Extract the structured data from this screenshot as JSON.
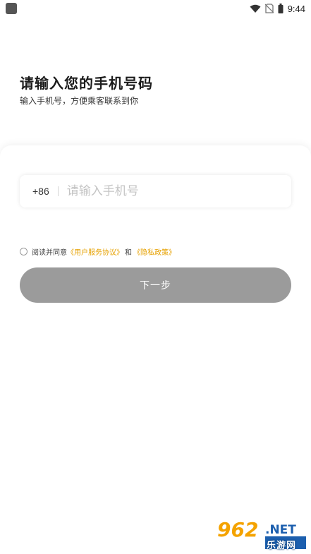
{
  "status_bar": {
    "time": "9:44"
  },
  "header": {
    "title": "请输入您的手机号码",
    "subtitle": "输入手机号，方便乘客联系到你"
  },
  "form": {
    "country_code": "+86",
    "phone_placeholder": "请输入手机号",
    "phone_value": ""
  },
  "agreement": {
    "prefix": "阅读并同意",
    "user_agreement": "《用户服务协议》",
    "conjunction": "和",
    "privacy_policy": "《隐私政策》"
  },
  "actions": {
    "next_label": "下一步"
  },
  "colors": {
    "link": "#e6a100",
    "button_disabled": "#9b9b9b"
  },
  "watermark": {
    "logo_text": "962.NET",
    "sub_text": "乐游网"
  }
}
